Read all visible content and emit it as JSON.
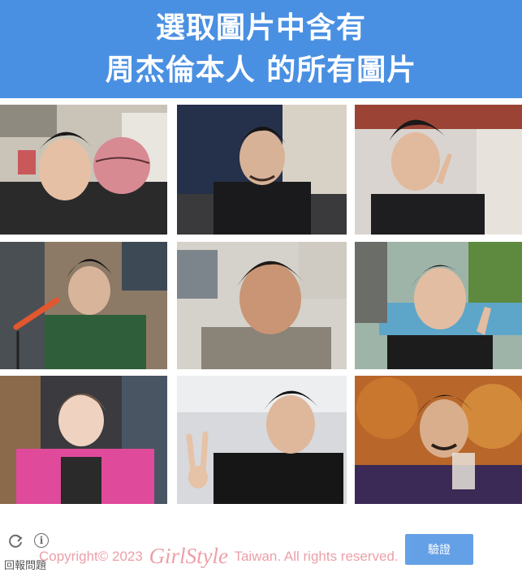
{
  "header": {
    "line1": "選取圖片中含有",
    "line2": "周杰倫本人 的所有圖片"
  },
  "grid": {
    "tiles": [
      {
        "label": "tile-1"
      },
      {
        "label": "tile-2"
      },
      {
        "label": "tile-3"
      },
      {
        "label": "tile-4"
      },
      {
        "label": "tile-5"
      },
      {
        "label": "tile-6"
      },
      {
        "label": "tile-7"
      },
      {
        "label": "tile-8"
      },
      {
        "label": "tile-9"
      }
    ]
  },
  "controls": {
    "reload_icon": "reload-icon",
    "info_icon": "info-icon",
    "info_glyph": "i",
    "report_label": "回報問題",
    "verify_label": "驗證"
  },
  "watermark": {
    "prefix": "Copyright© 2023",
    "brand": "GirlStyle",
    "suffix": "Taiwan. All rights reserved."
  },
  "colors": {
    "accent": "#4a90e2",
    "watermark": "#e88a94"
  }
}
